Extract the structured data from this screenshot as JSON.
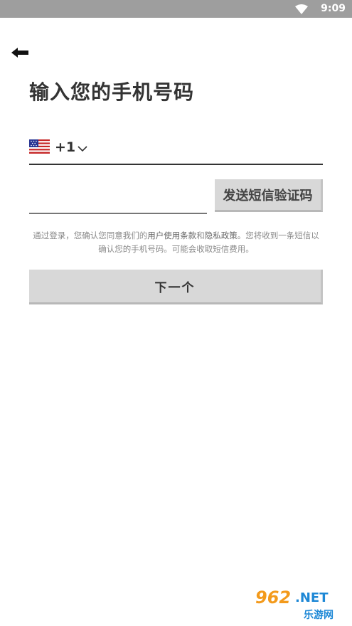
{
  "status_bar": {
    "time": "9:09"
  },
  "page": {
    "title": "输入您的手机号码",
    "country_code": "+1",
    "country_flag": "US",
    "send_code_label": "发送短信验证码",
    "notice": {
      "prefix": "通过登录，您确认您同意我们的",
      "terms_link": "用户使用条款",
      "and": "和",
      "privacy_link": "隐私政策",
      "suffix": "。您将收到一条短信以确认您的手机号码。可能会收取短信费用。"
    },
    "next_label": "下一个"
  },
  "watermark": {
    "logo_text": "962.NET",
    "site_text": "乐游网"
  },
  "colors": {
    "status_bar": "#9e9e9e",
    "button_bg": "#d8d8d8",
    "text_dark": "#333333",
    "text_muted": "#8a8a8a",
    "watermark_orange": "#f39a1c",
    "watermark_blue": "#1e88d6"
  }
}
